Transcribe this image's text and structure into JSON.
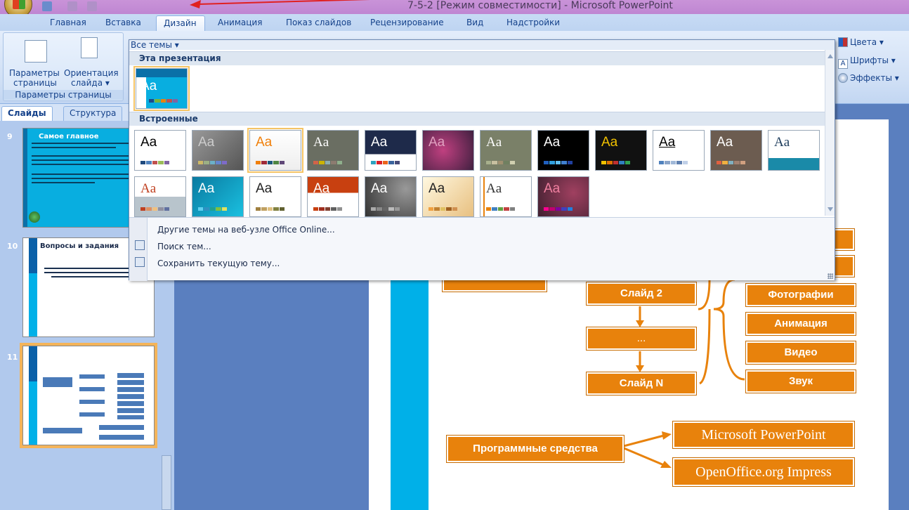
{
  "window": {
    "title": "7-5-2 [Режим совместимости] - Microsoft PowerPoint"
  },
  "ribbon": {
    "tabs": [
      "Главная",
      "Вставка",
      "Дизайн",
      "Анимация",
      "Показ слайдов",
      "Рецензирование",
      "Вид",
      "Надстройки"
    ],
    "active_tab": "Дизайн",
    "page_setup": {
      "btn1_line1": "Параметры",
      "btn1_line2": "страницы",
      "btn2_line1": "Ориентация",
      "btn2_line2": "слайда ▾",
      "group_title": "Параметры страницы"
    },
    "right_commands": {
      "colors": "Цвета ▾",
      "fonts": "Шрифты ▾",
      "effects": "Эффекты ▾"
    }
  },
  "slides_pane": {
    "tab_slides": "Слайды",
    "tab_outline": "Структура",
    "slide9": {
      "num": "9",
      "title": "Самое главное"
    },
    "slide10": {
      "num": "10",
      "title": "Вопросы и задания"
    },
    "slide11": {
      "num": "11"
    }
  },
  "themes_dropdown": {
    "header": "Все темы ▾",
    "section_this": "Эта презентация",
    "section_builtin": "Встроенные",
    "aa": "Aa",
    "link_more": "Другие темы на веб-узле Office Online...",
    "link_search": "Поиск тем...",
    "link_save": "Сохранить текущую тему..."
  },
  "slide": {
    "box_slide2": "Слайд 2",
    "box_ellipsis": "...",
    "box_slideN": "Слайд N",
    "box_photos": "Фотографии",
    "box_animation": "Анимация",
    "box_video": "Видео",
    "box_sound": "Звук",
    "box_software": "Программные средства",
    "box_ppt": "Microsoft PowerPoint",
    "box_ooo": "OpenOffice.org Impress"
  },
  "colors": {
    "accent_orange": "#e8820c",
    "slide_bar": "#00b0e8",
    "ribbon_blue": "#15428b"
  }
}
